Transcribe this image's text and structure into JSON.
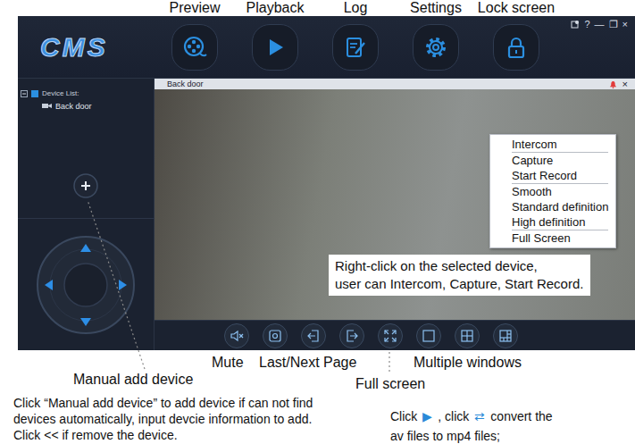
{
  "nav": [
    {
      "label": "Preview"
    },
    {
      "label": "Playback"
    },
    {
      "label": "Log"
    },
    {
      "label": "Settings"
    },
    {
      "label": "Lock screen"
    }
  ],
  "app": {
    "logo": "CMS",
    "window_controls": [
      "?",
      "—",
      "❐",
      "×"
    ]
  },
  "device_list": {
    "title": "Device List:",
    "expanded": true,
    "items": [
      {
        "name": "Back door",
        "selected": false
      }
    ]
  },
  "video": {
    "title": "Back door",
    "close": "×"
  },
  "context_menu": {
    "groups": [
      [
        "Intercom"
      ],
      [
        "Capture",
        "Start Record"
      ],
      [
        "Smooth",
        "Standard definition",
        "High definition"
      ],
      [
        "Full Screen"
      ]
    ]
  },
  "callout": {
    "lines": [
      "Right-click on the selected device,",
      "user can Intercom, Capture, Start Record."
    ]
  },
  "labels": [
    {
      "text": "Mute"
    },
    {
      "text": "Last/Next Page"
    },
    {
      "text": "Multiple windows"
    },
    {
      "text": "Manual add device"
    },
    {
      "text": "Full screen"
    }
  ],
  "notes": {
    "left": [
      "Click “Manual add device” to add device if can not find",
      "devices automatically, input devcie information to add.",
      "Click << if remove the device."
    ],
    "right": {
      "lines": [
        [
          {
            "kind": "text",
            "text": "Click"
          },
          {
            "kind": "icon",
            "text": "▶"
          },
          {
            "kind": "text",
            "text": ", click"
          },
          {
            "kind": "icon",
            "text": "⇄"
          },
          {
            "kind": "text",
            "text": "convert the"
          }
        ],
        [
          {
            "kind": "text",
            "text": "av files to mp4 files;"
          }
        ]
      ]
    }
  }
}
